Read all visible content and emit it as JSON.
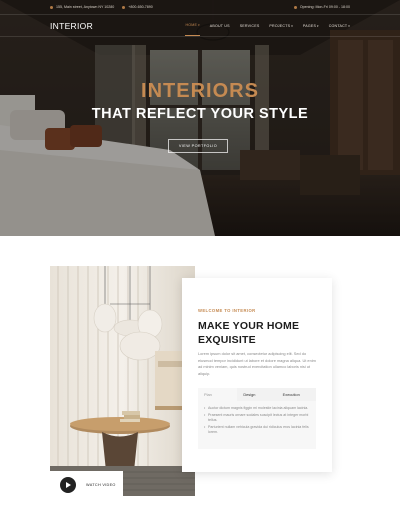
{
  "topbar": {
    "address": "155, Main street, Anytown NY 10280",
    "phone": "+800-650-7890",
    "hours": "Opening: Mon-Fri 09:00 - 18:00"
  },
  "nav": {
    "logo": "INTERIOR",
    "items": [
      {
        "label": "HOME",
        "caret": "▾"
      },
      {
        "label": "ABOUT US",
        "caret": ""
      },
      {
        "label": "SERVICES",
        "caret": ""
      },
      {
        "label": "PROJECTS",
        "caret": "▾"
      },
      {
        "label": "PAGES",
        "caret": "▾"
      },
      {
        "label": "CONTACT",
        "caret": "▾"
      }
    ]
  },
  "hero": {
    "title_line1": "INTERIORS",
    "title_line2": "THAT REFLECT YOUR STYLE",
    "button": "VIEW PORTFOLIO"
  },
  "about": {
    "eyebrow": "WELCOME TO INTERIOR",
    "title": "MAKE YOUR HOME EXQUISITE",
    "text": "Lorem ipsum dolor sit amet, consectetur adipiscing elit. Sed do eiusmod tempor incididunt ut labore et dolore magna aliqua. Ut enim ad minim veniam, quis nostrud exercitation ullamco laboris nisi ut aliquip.",
    "tabs": [
      "Plan",
      "Design",
      "Execution"
    ],
    "bullets": [
      "Auctor dictum magnis figgin mi molestie lacinia aliquam lacinia.",
      "Praesent mauris ornare sodales suscipit lectus at integer morbi tellus.",
      "Parturient nullam vehicula gravida dui ridiculus eros lacinia felis lorem."
    ],
    "watch_label": "WATCH VIDEO"
  },
  "colors": {
    "accent": "#c58a52",
    "dark": "#1d1d1d"
  }
}
